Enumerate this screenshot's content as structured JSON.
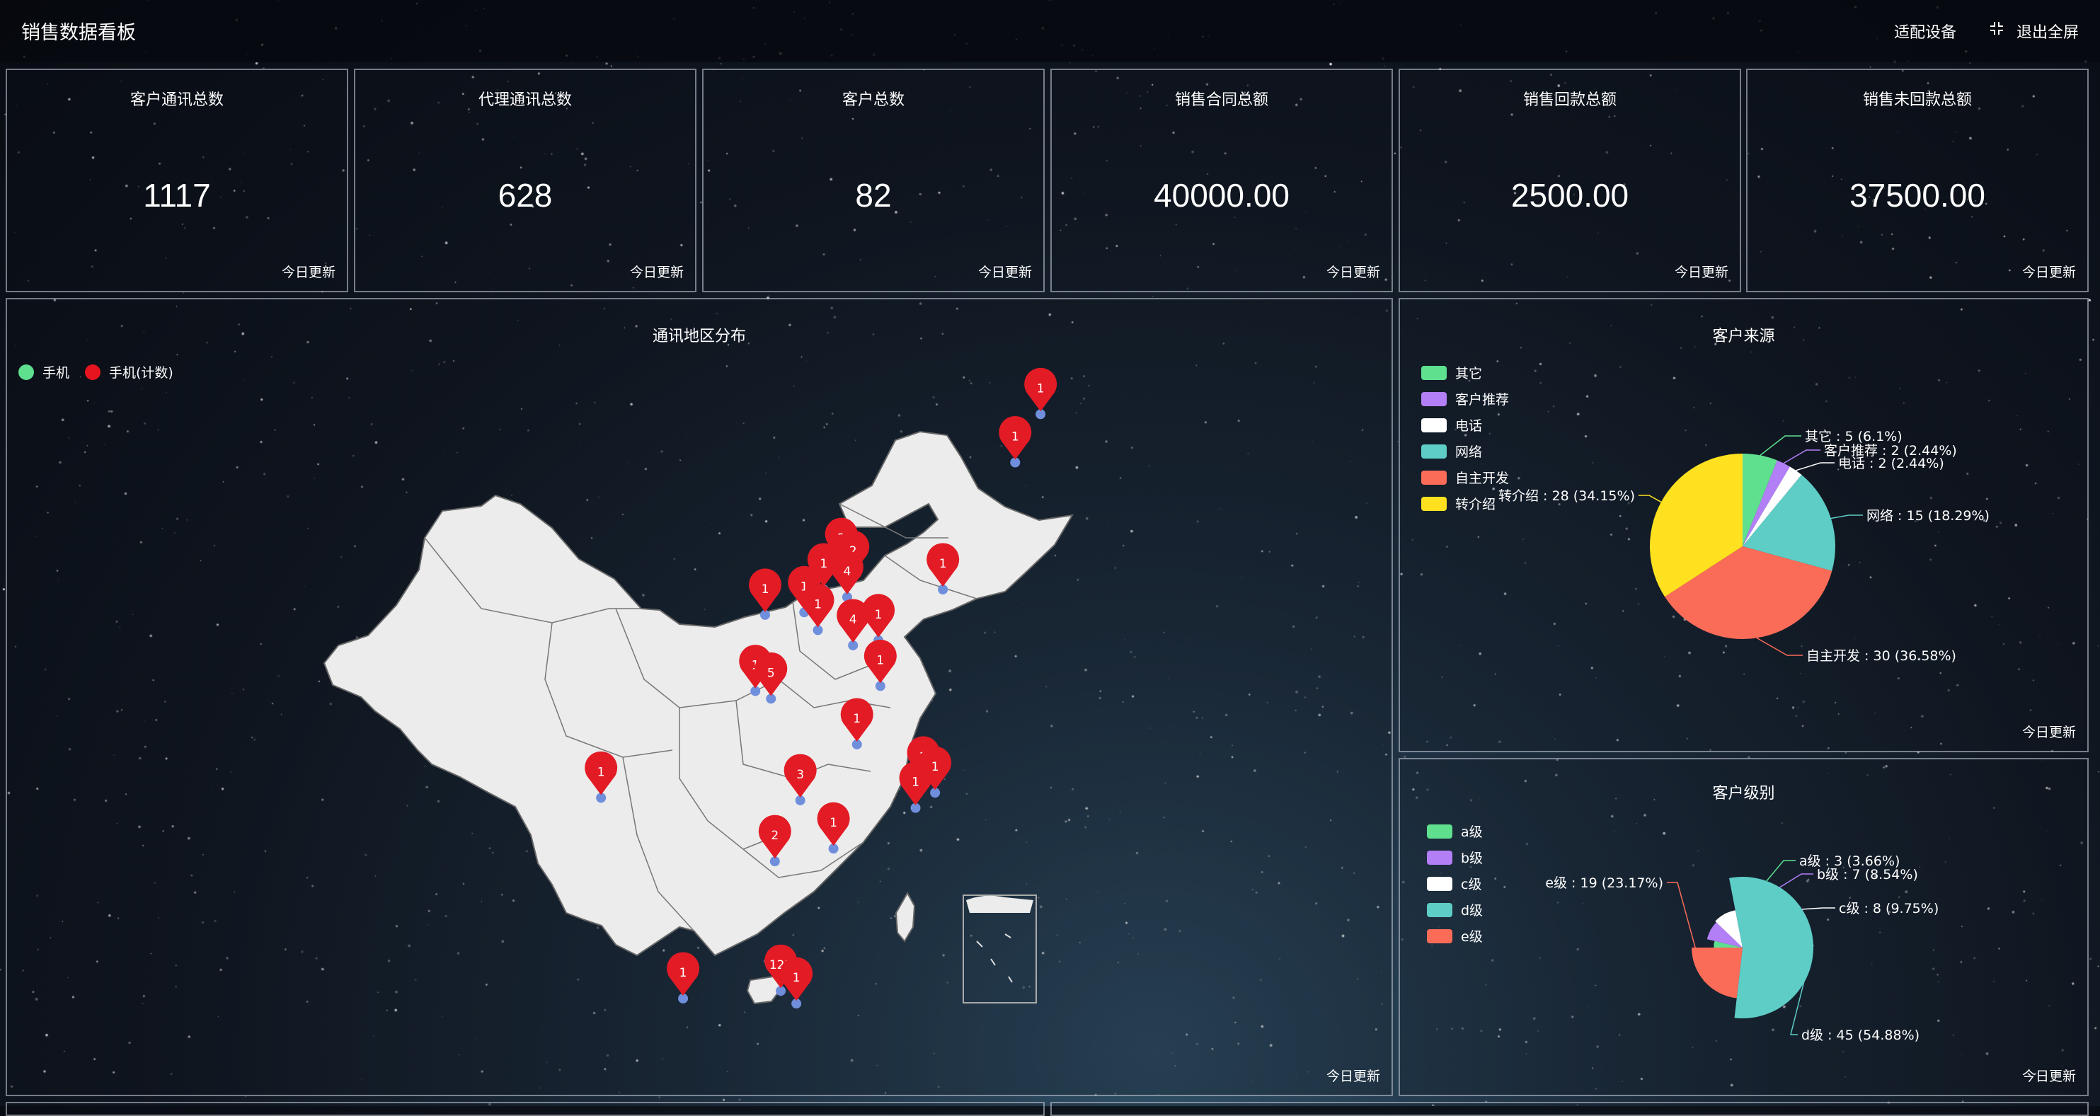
{
  "header": {
    "title": "销售数据看板",
    "adapt_label": "适配设备",
    "fullscreen_label": "退出全屏",
    "fullscreen_icon": "fullscreen-exit-icon"
  },
  "kpis": [
    {
      "title": "客户通讯总数",
      "value": "1117",
      "update": "今日更新"
    },
    {
      "title": "代理通讯总数",
      "value": "628",
      "update": "今日更新"
    },
    {
      "title": "客户总数",
      "value": "82",
      "update": "今日更新"
    },
    {
      "title": "销售合同总额",
      "value": "40000.00",
      "update": "今日更新"
    },
    {
      "title": "销售回款总额",
      "value": "2500.00",
      "update": "今日更新"
    },
    {
      "title": "销售未回款总额",
      "value": "37500.00",
      "update": "今日更新"
    }
  ],
  "map_panel": {
    "title": "通讯地区分布",
    "update": "今日更新",
    "legend": [
      {
        "label": "手机",
        "color": "#5ee08f"
      },
      {
        "label": "手机(计数)",
        "color": "#e6141f"
      }
    ],
    "pin_color": "#e31b25",
    "dot_color": "#6f8fdc",
    "map_color": "#ececec"
  },
  "source_panel": {
    "title": "客户来源",
    "update": "今日更新"
  },
  "level_panel": {
    "title": "客户级别",
    "update": "今日更新"
  },
  "chart_data": [
    {
      "type": "scatter",
      "subtype": "map-pins",
      "title": "通讯地区分布",
      "series": [
        {
          "name": "手机(计数)"
        }
      ],
      "pins": [
        {
          "label": "1",
          "lng": 126.6,
          "lat": 45.8
        },
        {
          "label": "1",
          "lng": 125.3,
          "lat": 43.9
        },
        {
          "label": "1",
          "lng": 121.6,
          "lat": 38.9
        },
        {
          "label": "2",
          "lng": 116.4,
          "lat": 39.9
        },
        {
          "label": "2",
          "lng": 117.0,
          "lat": 39.4
        },
        {
          "label": "4",
          "lng": 116.7,
          "lat": 38.6
        },
        {
          "label": "1",
          "lng": 115.5,
          "lat": 38.9
        },
        {
          "label": "1",
          "lng": 114.5,
          "lat": 38.0
        },
        {
          "label": "1",
          "lng": 112.5,
          "lat": 37.9
        },
        {
          "label": "1",
          "lng": 115.2,
          "lat": 37.3
        },
        {
          "label": "4",
          "lng": 117.0,
          "lat": 36.7
        },
        {
          "label": "1",
          "lng": 118.3,
          "lat": 36.9
        },
        {
          "label": "1",
          "lng": 118.4,
          "lat": 35.1
        },
        {
          "label": "1",
          "lng": 112.0,
          "lat": 34.9
        },
        {
          "label": "5",
          "lng": 112.8,
          "lat": 34.6
        },
        {
          "label": "1",
          "lng": 117.2,
          "lat": 32.8
        },
        {
          "label": "2",
          "lng": 120.6,
          "lat": 31.3
        },
        {
          "label": "1",
          "lng": 120.2,
          "lat": 30.3
        },
        {
          "label": "1",
          "lng": 121.2,
          "lat": 30.9
        },
        {
          "label": "3",
          "lng": 114.3,
          "lat": 30.6
        },
        {
          "label": "1",
          "lng": 116.0,
          "lat": 28.7
        },
        {
          "label": "2",
          "lng": 113.0,
          "lat": 28.2
        },
        {
          "label": "1",
          "lng": 104.1,
          "lat": 30.7
        },
        {
          "label": "121",
          "lng": 113.3,
          "lat": 23.1
        },
        {
          "label": "1",
          "lng": 114.1,
          "lat": 22.6
        },
        {
          "label": "1",
          "lng": 108.3,
          "lat": 22.8
        }
      ]
    },
    {
      "type": "pie",
      "title": "客户来源",
      "series": [
        {
          "name": "其它",
          "value": 5,
          "color": "#5ee08f",
          "label": "其它 : 5 (6.1%)"
        },
        {
          "name": "客户推荐",
          "value": 2,
          "color": "#b37ff7",
          "label": "客户推荐 : 2 (2.44%)"
        },
        {
          "name": "电话",
          "value": 2,
          "color": "#ffffff",
          "label": "电话 : 2 (2.44%)"
        },
        {
          "name": "网络",
          "value": 15,
          "color": "#5ecdc6",
          "label": "网络 : 15 (18.29%)"
        },
        {
          "name": "自主开发",
          "value": 30,
          "color": "#fa6c58",
          "label": "自主开发 : 30 (36.58%)"
        },
        {
          "name": "转介绍",
          "value": 28,
          "color": "#ffe11f",
          "label": "转介绍 : 28 (34.15%)"
        }
      ],
      "legend": "top-left"
    },
    {
      "type": "pie",
      "subtype": "rose",
      "title": "客户级别",
      "series": [
        {
          "name": "a级",
          "value": 3,
          "color": "#5ee08f",
          "label": "a级 : 3 (3.66%)"
        },
        {
          "name": "b级",
          "value": 7,
          "color": "#b37ff7",
          "label": "b级 : 7 (8.54%)"
        },
        {
          "name": "c级",
          "value": 8,
          "color": "#ffffff",
          "label": "c级 : 8 (9.75%)"
        },
        {
          "name": "d级",
          "value": 45,
          "color": "#5ecdc6",
          "label": "d级 : 45 (54.88%)"
        },
        {
          "name": "e级",
          "value": 19,
          "color": "#fa6c58",
          "label": "e级 : 19 (23.17%)"
        }
      ],
      "legend": "top-left"
    }
  ]
}
